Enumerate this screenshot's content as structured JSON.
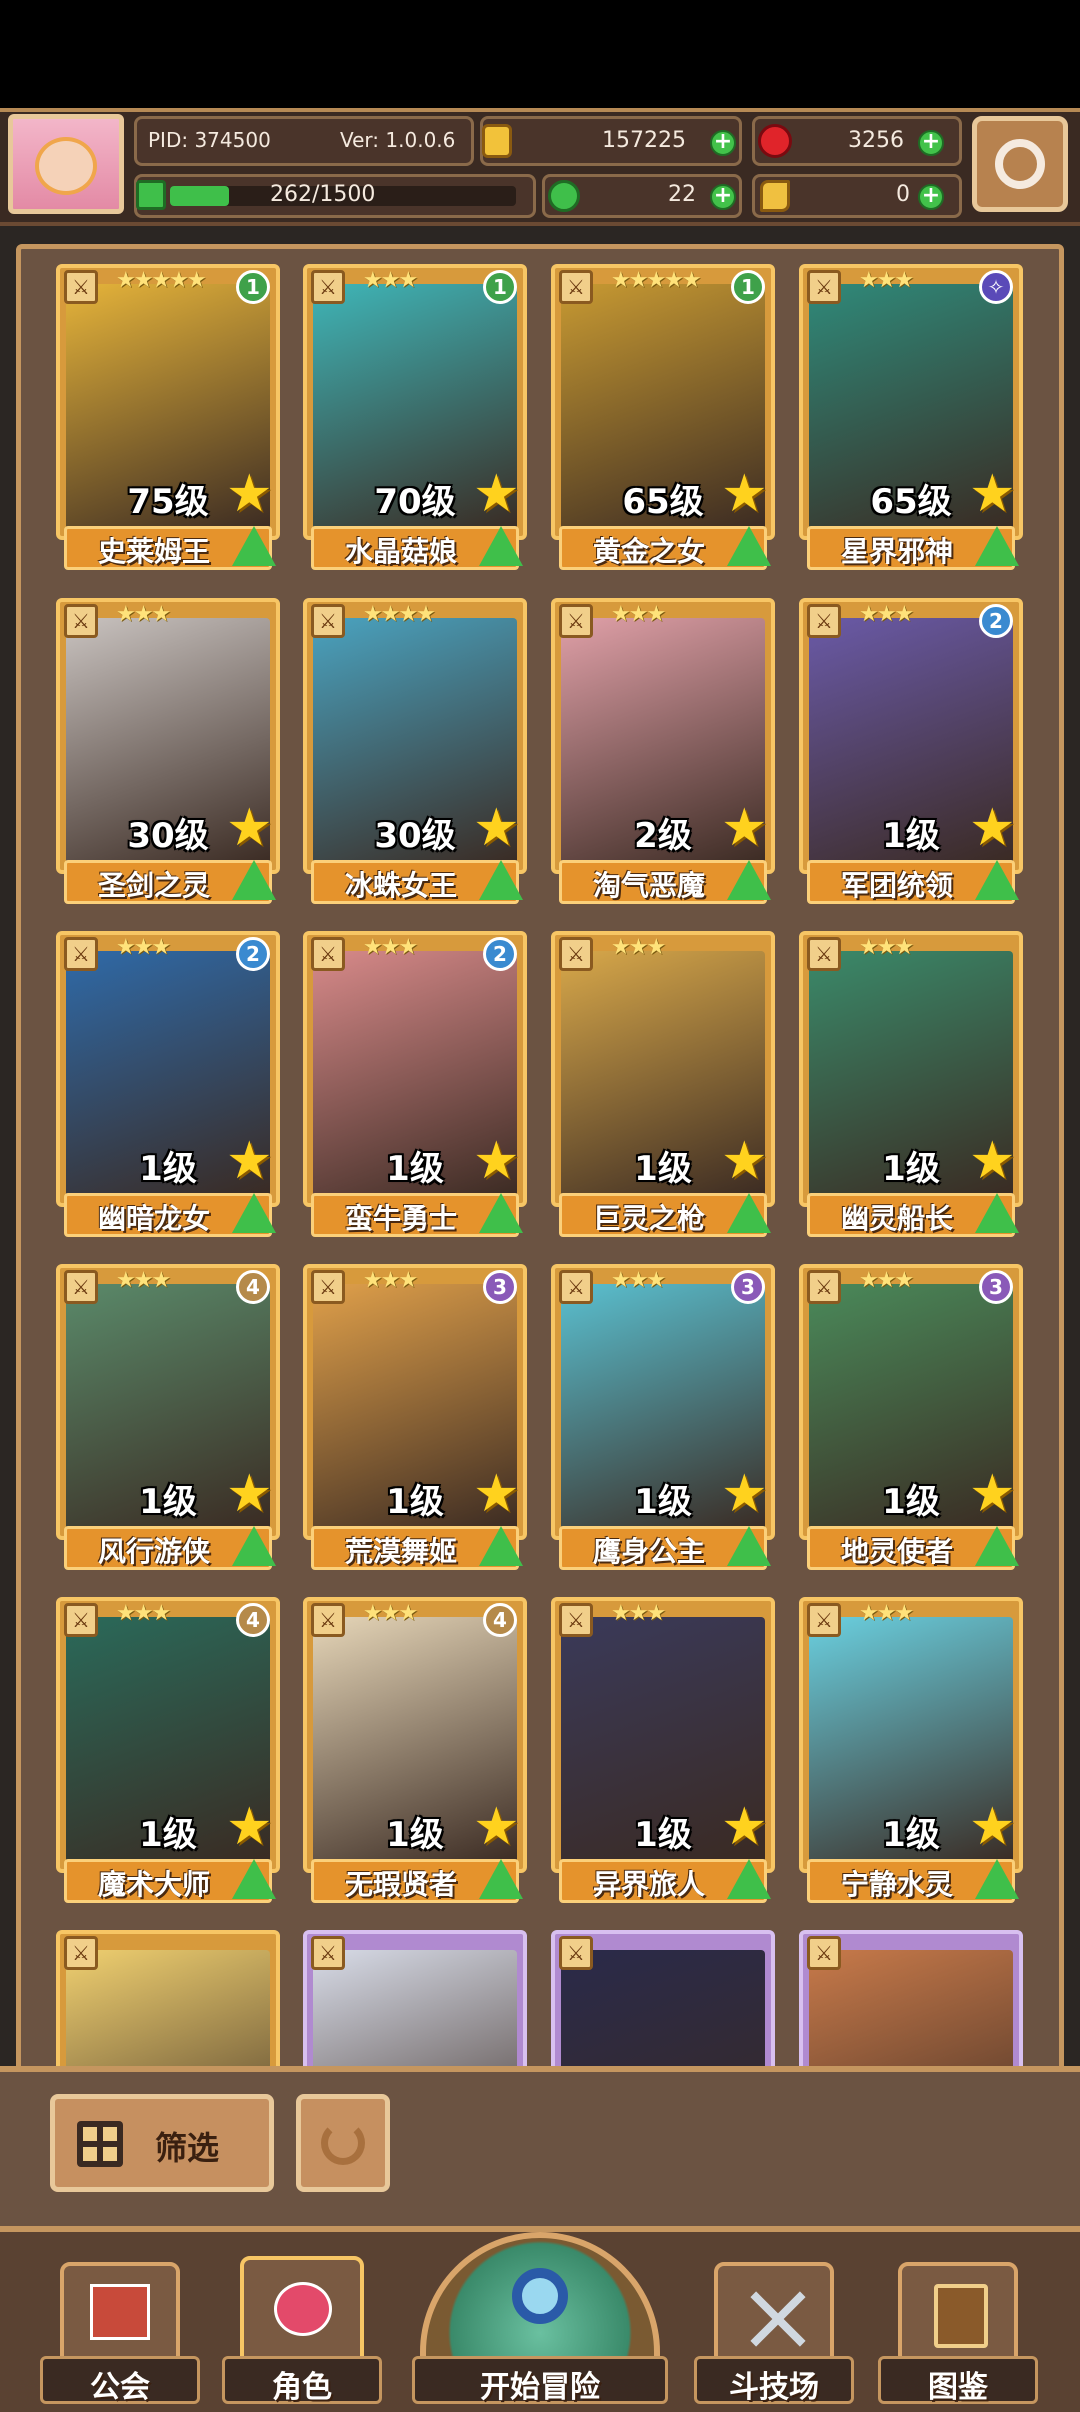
{
  "header": {
    "pid": "PID: 374500",
    "version": "Ver: 1.0.0.6",
    "gold": "157225",
    "gems": "3256",
    "energy": "262/1500",
    "clover": "22",
    "feather": "0",
    "energy_progress": 0.17
  },
  "heroes": [
    {
      "level": "75级",
      "name": "史莱姆王",
      "badge": "1",
      "badge_color": "#3fa14a",
      "stars": "★★★★★"
    },
    {
      "level": "70级",
      "name": "水晶菇娘",
      "badge": "1",
      "badge_color": "#3fa14a",
      "stars": "★★★"
    },
    {
      "level": "65级",
      "name": "黄金之女",
      "badge": "1",
      "badge_color": "#3fa14a",
      "stars": "★★★★★"
    },
    {
      "level": "65级",
      "name": "星界邪神",
      "badge": "✧",
      "badge_color": "#5a4ab8",
      "stars": "★★★"
    },
    {
      "level": "30级",
      "name": "圣剑之灵",
      "badge": "",
      "badge_color": "",
      "stars": "★★★"
    },
    {
      "level": "30级",
      "name": "冰蛛女王",
      "badge": "",
      "badge_color": "",
      "stars": "★★★★"
    },
    {
      "level": "2级",
      "name": "淘气恶魔",
      "badge": "",
      "badge_color": "",
      "stars": "★★★"
    },
    {
      "level": "1级",
      "name": "军团统领",
      "badge": "2",
      "badge_color": "#3a8ad0",
      "stars": "★★★"
    },
    {
      "level": "1级",
      "name": "幽暗龙女",
      "badge": "2",
      "badge_color": "#3a8ad0",
      "stars": "★★★"
    },
    {
      "level": "1级",
      "name": "蛮牛勇士",
      "badge": "2",
      "badge_color": "#3a8ad0",
      "stars": "★★★"
    },
    {
      "level": "1级",
      "name": "巨灵之枪",
      "badge": "",
      "badge_color": "",
      "stars": "★★★"
    },
    {
      "level": "1级",
      "name": "幽灵船长",
      "badge": "",
      "badge_color": "",
      "stars": "★★★"
    },
    {
      "level": "1级",
      "name": "风行游侠",
      "badge": "4",
      "badge_color": "#b58a4a",
      "stars": "★★★"
    },
    {
      "level": "1级",
      "name": "荒漠舞姬",
      "badge": "3",
      "badge_color": "#8a5ab8",
      "stars": "★★★"
    },
    {
      "level": "1级",
      "name": "鹰身公主",
      "badge": "3",
      "badge_color": "#8a5ab8",
      "stars": "★★★"
    },
    {
      "level": "1级",
      "name": "地灵使者",
      "badge": "3",
      "badge_color": "#8a5ab8",
      "stars": "★★★"
    },
    {
      "level": "1级",
      "name": "魔术大师",
      "badge": "4",
      "badge_color": "#b58a4a",
      "stars": "★★★"
    },
    {
      "level": "1级",
      "name": "无瑕贤者",
      "badge": "4",
      "badge_color": "#b58a4a",
      "stars": "★★★"
    },
    {
      "level": "1级",
      "name": "异界旅人",
      "badge": "",
      "badge_color": "",
      "stars": "★★★"
    },
    {
      "level": "1级",
      "name": "宁静水灵",
      "badge": "",
      "badge_color": "",
      "stars": "★★★"
    }
  ],
  "hero_art_colors": [
    "#e6b43a",
    "#3fb6b8",
    "#c89a32",
    "#2f8a7a",
    "#c9c3c0",
    "#4aa3c0",
    "#e0a0a8",
    "#6a5aa8",
    "#2f6aa8",
    "#d88a8a",
    "#d8a84a",
    "#3a8a6a",
    "#5a8a6a",
    "#e0a04a",
    "#5ac0d0",
    "#4a8a5a",
    "#2a6a5a",
    "#e6d6b8",
    "#3a3a5a",
    "#6ad0e0"
  ],
  "partial_art_colors": [
    "#f0d070",
    "#d8dce8",
    "#2a2a4a",
    "#c87a4a"
  ],
  "toolbar": {
    "filter_label": "筛选"
  },
  "nav": {
    "guild": "公会",
    "hero": "角色",
    "adventure": "开始冒险",
    "arena": "斗技场",
    "codex": "图鉴"
  },
  "colors": {
    "accent": "#d79a3c",
    "panel": "#6b5342",
    "green": "#3fbf4a"
  }
}
